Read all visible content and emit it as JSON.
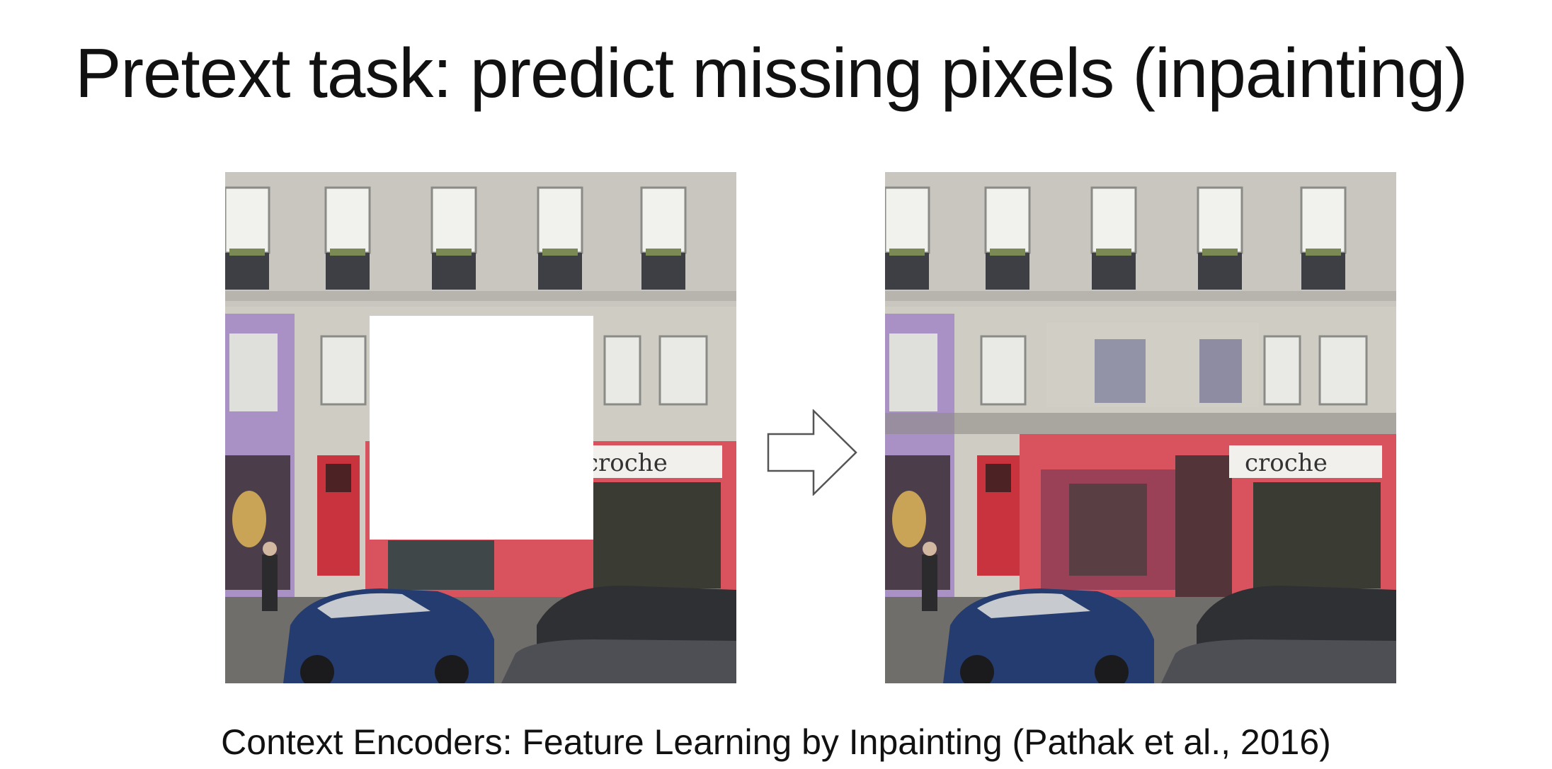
{
  "slide": {
    "title": "Pretext task: predict missing pixels (inpainting)",
    "caption": "Context Encoders: Feature Learning by Inpainting (Pathak et al., 2016)"
  },
  "images": {
    "masked": {
      "storefront_sign": "croche"
    },
    "inpainted": {
      "storefront_sign": "croche"
    }
  },
  "colors": {
    "background": "#ffffff",
    "text": "#111111",
    "facade": "#cfccc4",
    "shopfront_red": "#d9535f",
    "lilac_trim": "#a991c6",
    "car_blue": "#243c70"
  }
}
